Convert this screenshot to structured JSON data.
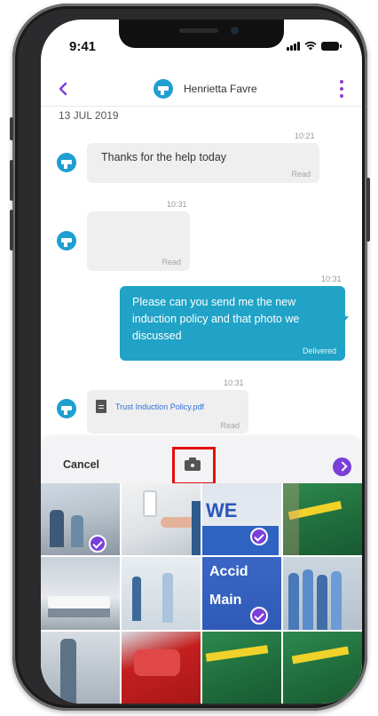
{
  "status_bar": {
    "time": "9:41"
  },
  "header": {
    "contact_name": "Henrietta Favre"
  },
  "conversation": {
    "date": "13 JUL 2019",
    "messages": [
      {
        "time": "10:21",
        "text": "Thanks for the help today",
        "status": "Read"
      },
      {
        "time": "10:31",
        "text": "",
        "status": "Read"
      },
      {
        "time": "10:31",
        "lines": [
          "Please can you send me the new",
          "induction policy and that photo we",
          "discussed"
        ],
        "status": "Delivered"
      },
      {
        "time": "10:31",
        "file_name": "Trust Induction Policy.pdf",
        "status": "Read"
      }
    ]
  },
  "picker": {
    "cancel_label": "Cancel",
    "photos": [
      {
        "desc": "hospital staff",
        "selected": true
      },
      {
        "desc": "hand sanitiser",
        "selected": false
      },
      {
        "desc": "we love our nhs sign",
        "selected": true
      },
      {
        "desc": "ambulance staff",
        "selected": false
      },
      {
        "desc": "hospital bed",
        "selected": false
      },
      {
        "desc": "doctors in corridor",
        "selected": false
      },
      {
        "desc": "accident and emergency sign",
        "selected": true
      },
      {
        "desc": "nurses group",
        "selected": false
      },
      {
        "desc": "staff member",
        "selected": false
      },
      {
        "desc": "red bin",
        "selected": false
      },
      {
        "desc": "ambulance jacket",
        "selected": false
      },
      {
        "desc": "ambulance jacket",
        "selected": false
      }
    ]
  },
  "colors": {
    "accent": "#7a3fd8",
    "bubble_out": "#20a3c6",
    "highlight": "#e30e0e"
  }
}
